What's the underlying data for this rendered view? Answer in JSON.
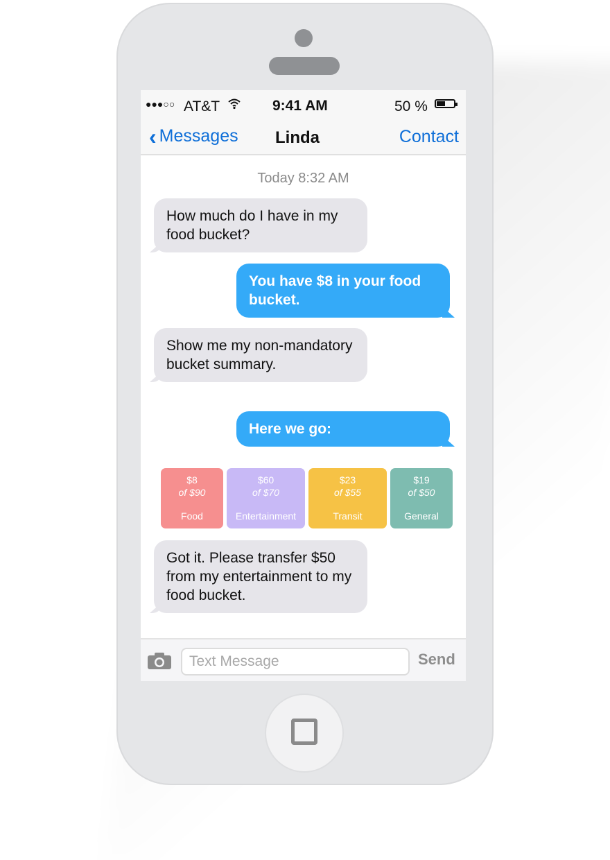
{
  "status_bar": {
    "signal": "●●●○○",
    "carrier": "AT&T",
    "time": "9:41 AM",
    "battery_percent": "50 %",
    "battery_level": 0.5
  },
  "nav": {
    "back_label": "Messages",
    "title": "Linda",
    "contact_label": "Contact"
  },
  "conversation": {
    "timestamp": "Today 8:32 AM",
    "messages": [
      {
        "from": "user",
        "text": "How much do I have in my food bucket?"
      },
      {
        "from": "bot",
        "text": "You have $8 in your food bucket."
      },
      {
        "from": "user",
        "text": "Show me my non-mandatory bucket summary."
      },
      {
        "from": "bot",
        "text": "Here we go:"
      },
      {
        "from": "user",
        "text": "Got it. Please transfer $50 from my entertainment to my food bucket."
      }
    ]
  },
  "buckets": [
    {
      "amount": "$8",
      "of": "of $90",
      "name": "Food",
      "color": "#f68f8f"
    },
    {
      "amount": "$60",
      "of": "of $70",
      "name": "Entertainment",
      "color": "#c8b9f6"
    },
    {
      "amount": "$23",
      "of": "of $55",
      "name": "Transit",
      "color": "#f6c245"
    },
    {
      "amount": "$19",
      "of": "of $50",
      "name": "General",
      "color": "#7ebcb0"
    }
  ],
  "composer": {
    "placeholder": "Text Message",
    "send_label": "Send"
  },
  "colors": {
    "link_blue": "#0f6fd8",
    "outgoing_bubble": "#34aaf8",
    "incoming_bubble": "#e6e5ea"
  }
}
